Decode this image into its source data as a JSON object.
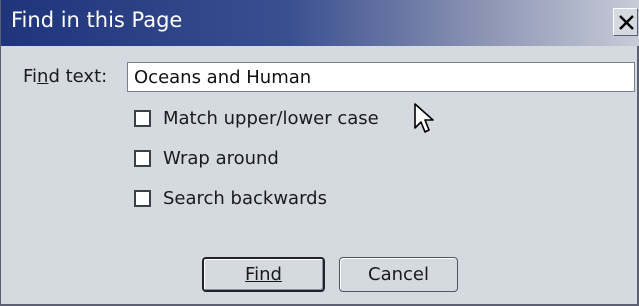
{
  "dialog": {
    "title": "Find in this Page",
    "close_label": "X"
  },
  "find": {
    "label_prefix": "Fi",
    "label_accel": "n",
    "label_suffix": "d text:",
    "value": "Oceans and Human"
  },
  "options": [
    {
      "label": "Match upper/lower case",
      "checked": false
    },
    {
      "label": "Wrap around",
      "checked": false
    },
    {
      "label": "Search backwards",
      "checked": false
    }
  ],
  "buttons": {
    "find_label": "Find",
    "cancel_label": "Cancel"
  },
  "icons": {
    "close": "close-icon",
    "cursor": "mouse-pointer-icon"
  },
  "colors": {
    "titlebar_start": "#1e347c",
    "titlebar_end": "#c8ccd8",
    "dialog_bg": "#d5d9e0"
  }
}
